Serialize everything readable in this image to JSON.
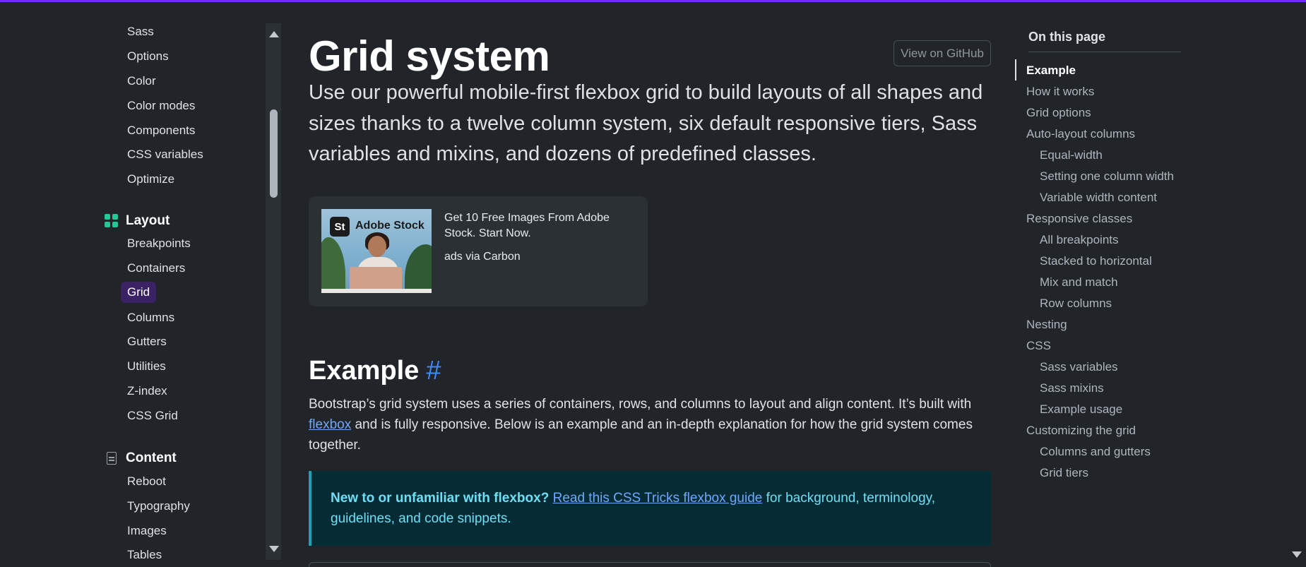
{
  "sidebar": {
    "items_top": [
      "Sass",
      "Options",
      "Color",
      "Color modes",
      "Components",
      "CSS variables",
      "Optimize"
    ],
    "layout_group": "Layout",
    "layout_items": [
      "Breakpoints",
      "Containers",
      "Grid",
      "Columns",
      "Gutters",
      "Utilities",
      "Z-index",
      "CSS Grid"
    ],
    "content_group": "Content",
    "content_items": [
      "Reboot",
      "Typography",
      "Images",
      "Tables"
    ]
  },
  "main": {
    "title": "Grid system",
    "github_button": "View on GitHub",
    "lead": "Use our powerful mobile-first flexbox grid to build layouts of all shapes and sizes thanks to a twelve column system, six default responsive tiers, Sass variables and mixins, and dozens of predefined classes.",
    "ad": {
      "logo": "St",
      "brand": "Adobe Stock",
      "text": "Get 10 Free Images From Adobe Stock. Start Now.",
      "via": "ads via Carbon"
    },
    "section_heading": "Example",
    "anchor": "#",
    "paragraph_before_link": "Bootstrap’s grid system uses a series of containers, rows, and columns to layout and align content. It’s built with ",
    "paragraph_link": "flexbox",
    "paragraph_after_link": " and is fully responsive. Below is an example and an in-depth explanation for how the grid system comes together.",
    "callout": {
      "bold": "New to or unfamiliar with flexbox?",
      "link": "Read this CSS Tricks flexbox guide",
      "rest": " for background, terminology, guidelines, and code snippets."
    }
  },
  "toc": {
    "title": "On this page",
    "items": [
      {
        "label": "Example",
        "level": 1,
        "active": true
      },
      {
        "label": "How it works",
        "level": 1
      },
      {
        "label": "Grid options",
        "level": 1
      },
      {
        "label": "Auto-layout columns",
        "level": 1
      },
      {
        "label": "Equal-width",
        "level": 2
      },
      {
        "label": "Setting one column width",
        "level": 2
      },
      {
        "label": "Variable width content",
        "level": 2
      },
      {
        "label": "Responsive classes",
        "level": 1
      },
      {
        "label": "All breakpoints",
        "level": 2
      },
      {
        "label": "Stacked to horizontal",
        "level": 2
      },
      {
        "label": "Mix and match",
        "level": 2
      },
      {
        "label": "Row columns",
        "level": 2
      },
      {
        "label": "Nesting",
        "level": 1
      },
      {
        "label": "CSS",
        "level": 1
      },
      {
        "label": "Sass variables",
        "level": 2
      },
      {
        "label": "Sass mixins",
        "level": 2
      },
      {
        "label": "Example usage",
        "level": 2
      },
      {
        "label": "Customizing the grid",
        "level": 1
      },
      {
        "label": "Columns and gutters",
        "level": 2
      },
      {
        "label": "Grid tiers",
        "level": 2
      }
    ]
  },
  "colors": {
    "accent": "#712cf9",
    "background": "#212529",
    "active_nav": "#3b2264",
    "link": "#6ea8fe",
    "info": "#6edff6"
  }
}
